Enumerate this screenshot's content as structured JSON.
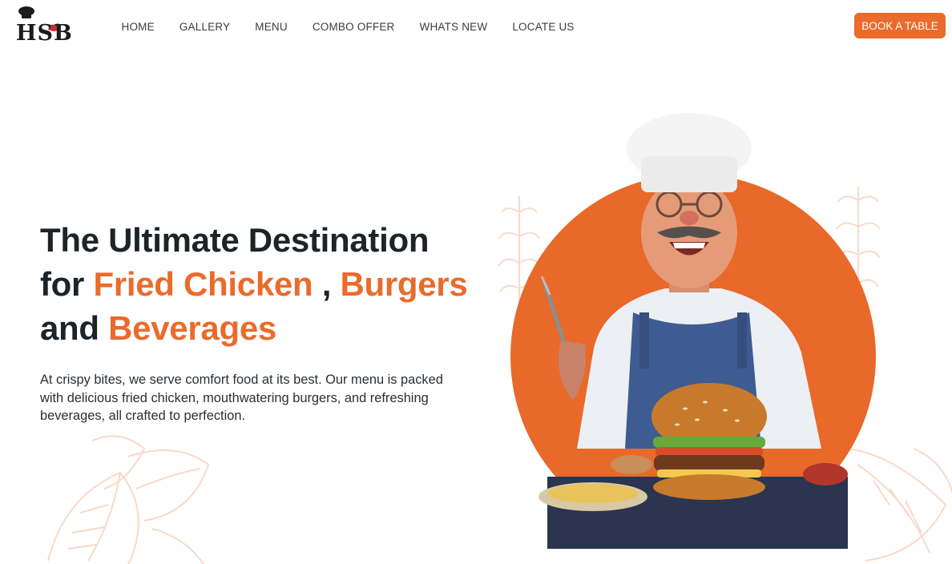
{
  "brand": {
    "logo_text": "HSB",
    "colors": {
      "accent": "#ea6b2b",
      "heading": "#1e2328",
      "text": "#2b2f33"
    }
  },
  "nav": {
    "items": [
      {
        "label": "HOME"
      },
      {
        "label": "GALLERY"
      },
      {
        "label": "MENU"
      },
      {
        "label": "COMBO OFFER"
      },
      {
        "label": "WHATS NEW"
      },
      {
        "label": "LOCATE US"
      }
    ],
    "cta_label": "BOOK A TABLE"
  },
  "hero": {
    "title_line1": "The Ultimate Destination",
    "title_for": "for",
    "title_accent1": "Fried Chicken",
    "title_comma": ",",
    "title_accent2": "Burgers",
    "title_and": "and",
    "title_accent3": "Beverages",
    "description": "At crispy bites, we serve comfort food at its best. Our menu is packed with delicious fried chicken, mouthwatering burgers, and refreshing beverages, all crafted to perfection.",
    "image_subject": "chef-with-burger-illustration"
  },
  "icons": {
    "logo": "chef-hat-chicken-logo-icon",
    "decor_left": "leaf-decor-icon",
    "decor_right": "leaf-decor-icon"
  }
}
